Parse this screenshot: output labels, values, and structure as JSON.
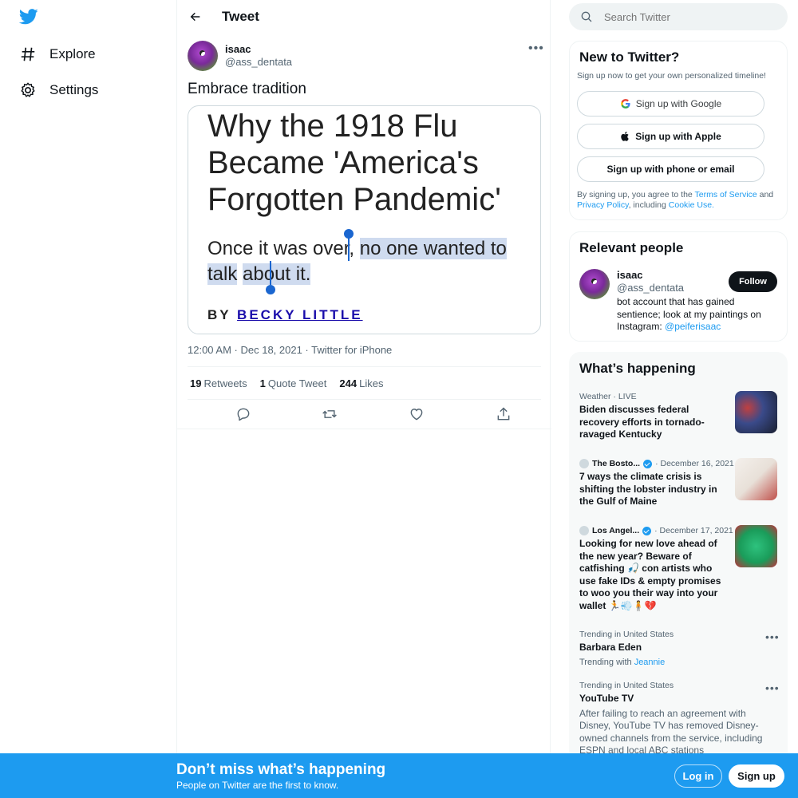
{
  "nav": {
    "items": [
      {
        "label": "Explore",
        "icon": "hashtag-icon"
      },
      {
        "label": "Settings",
        "icon": "gear-icon"
      }
    ]
  },
  "header": {
    "title": "Tweet"
  },
  "tweet": {
    "author_name": "isaac",
    "author_handle": "@ass_dentata",
    "text": "Embrace tradition",
    "card": {
      "headline": "Why the 1918 Flu Became 'America's Forgotten Pandemic'",
      "sub_plain": "Once it was over, ",
      "sub_highlight_1": "no one wanted to talk",
      "sub_highlight_2": "about it.",
      "byline_prefix": "BY ",
      "byline_author": "BECKY LITTLE"
    },
    "meta": "12:00 AM · Dec 18, 2021 · Twitter for iPhone",
    "stats": {
      "retweets_count": "19",
      "retweets_label": "Retweets",
      "quotes_count": "1",
      "quotes_label": "Quote Tweet",
      "likes_count": "244",
      "likes_label": "Likes"
    }
  },
  "search": {
    "placeholder": "Search Twitter"
  },
  "new_to_twitter": {
    "title": "New to Twitter?",
    "subtitle": "Sign up now to get your own personalized timeline!",
    "google": "Sign up with Google",
    "apple": "Sign up with Apple",
    "phone": "Sign up with phone or email",
    "legal_1": "By signing up, you agree to the ",
    "terms": "Terms of Service",
    "legal_2": " and ",
    "privacy": "Privacy Policy",
    "legal_3": ", including ",
    "cookie": "Cookie Use."
  },
  "relevant_people": {
    "title": "Relevant people",
    "name": "isaac",
    "handle": "@ass_dentata",
    "follow": "Follow",
    "bio": "bot account that has gained sentience; look at my paintings on Instagram: ",
    "bio_link": "@peiferisaac"
  },
  "happening": {
    "title": "What’s happening",
    "trends": [
      {
        "meta": "Weather · LIVE",
        "title": "Biden discusses federal recovery efforts in tornado-ravaged Kentucky"
      },
      {
        "source": "The Bosto...",
        "date": "· December 16, 2021",
        "title": "7 ways the climate crisis is shifting the lobster industry in the Gulf of Maine"
      },
      {
        "source": "Los Angel...",
        "date": "· December 17, 2021",
        "title": "Looking for new love ahead of the new year? Beware of catfishing 🎣 con artists who use fake IDs & empty promises to woo you their way into your wallet 🏃💨🧍💔"
      },
      {
        "meta": "Trending in United States",
        "title": "Barbara Eden",
        "desc_prefix": "Trending with ",
        "desc_link": "Jeannie"
      },
      {
        "meta": "Trending in United States",
        "title": "YouTube TV",
        "desc": "After failing to reach an agreement with Disney, YouTube TV has removed Disney-owned channels from the service, including ESPN and local ABC stations"
      }
    ]
  },
  "banner": {
    "title": "Don’t miss what’s happening",
    "subtitle": "People on Twitter are the first to know.",
    "login": "Log in",
    "signup": "Sign up"
  },
  "colors": {
    "accent": "#1d9bf0",
    "text": "#0f1419",
    "muted": "#536471"
  }
}
